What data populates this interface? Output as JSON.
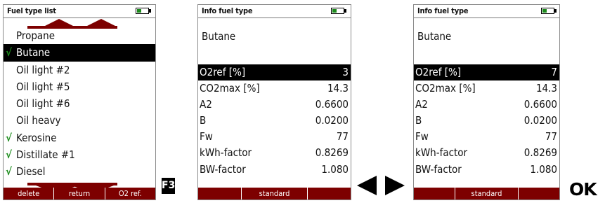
{
  "screen1": {
    "title": "Fuel type list",
    "items": [
      {
        "label": "Propane",
        "checked": false,
        "selected": false
      },
      {
        "label": "Butane",
        "checked": true,
        "selected": true
      },
      {
        "label": "Oil light #2",
        "checked": false,
        "selected": false
      },
      {
        "label": "Oil light #5",
        "checked": false,
        "selected": false
      },
      {
        "label": "Oil light #6",
        "checked": false,
        "selected": false
      },
      {
        "label": "Oil heavy",
        "checked": false,
        "selected": false
      },
      {
        "label": "Kerosine",
        "checked": true,
        "selected": false
      },
      {
        "label": "Distillate #1",
        "checked": true,
        "selected": false
      },
      {
        "label": "Diesel",
        "checked": true,
        "selected": false
      }
    ],
    "softkeys": [
      "delete",
      "return",
      "O2 ref."
    ],
    "check_mark": "√"
  },
  "key_label": "F3",
  "screen2": {
    "title": "Info fuel type",
    "fuel": "Butane",
    "params": [
      {
        "name": "O2ref [%]",
        "value": "3"
      },
      {
        "name": "CO2max [%]",
        "value": "14.3"
      },
      {
        "name": "A2",
        "value": "0.6600"
      },
      {
        "name": "B",
        "value": "0.0200"
      },
      {
        "name": "Fw",
        "value": "77"
      },
      {
        "name": "kWh-factor",
        "value": "0.8269"
      },
      {
        "name": "BW-factor",
        "value": "1.080"
      }
    ],
    "softkeys": [
      "",
      "standard",
      ""
    ]
  },
  "screen3": {
    "title": "Info fuel type",
    "fuel": "Butane",
    "params": [
      {
        "name": "O2ref [%]",
        "value": "7"
      },
      {
        "name": "CO2max [%]",
        "value": "14.3"
      },
      {
        "name": "A2",
        "value": "0.6600"
      },
      {
        "name": "B",
        "value": "0.0200"
      },
      {
        "name": "Fw",
        "value": "77"
      },
      {
        "name": "kWh-factor",
        "value": "0.8269"
      },
      {
        "name": "BW-factor",
        "value": "1.080"
      }
    ],
    "softkeys": [
      "",
      "standard",
      ""
    ]
  },
  "ok_label": "OK",
  "colors": {
    "accent": "#7d0000",
    "check": "#1b8c1b",
    "battery": "#1c8a1c"
  }
}
